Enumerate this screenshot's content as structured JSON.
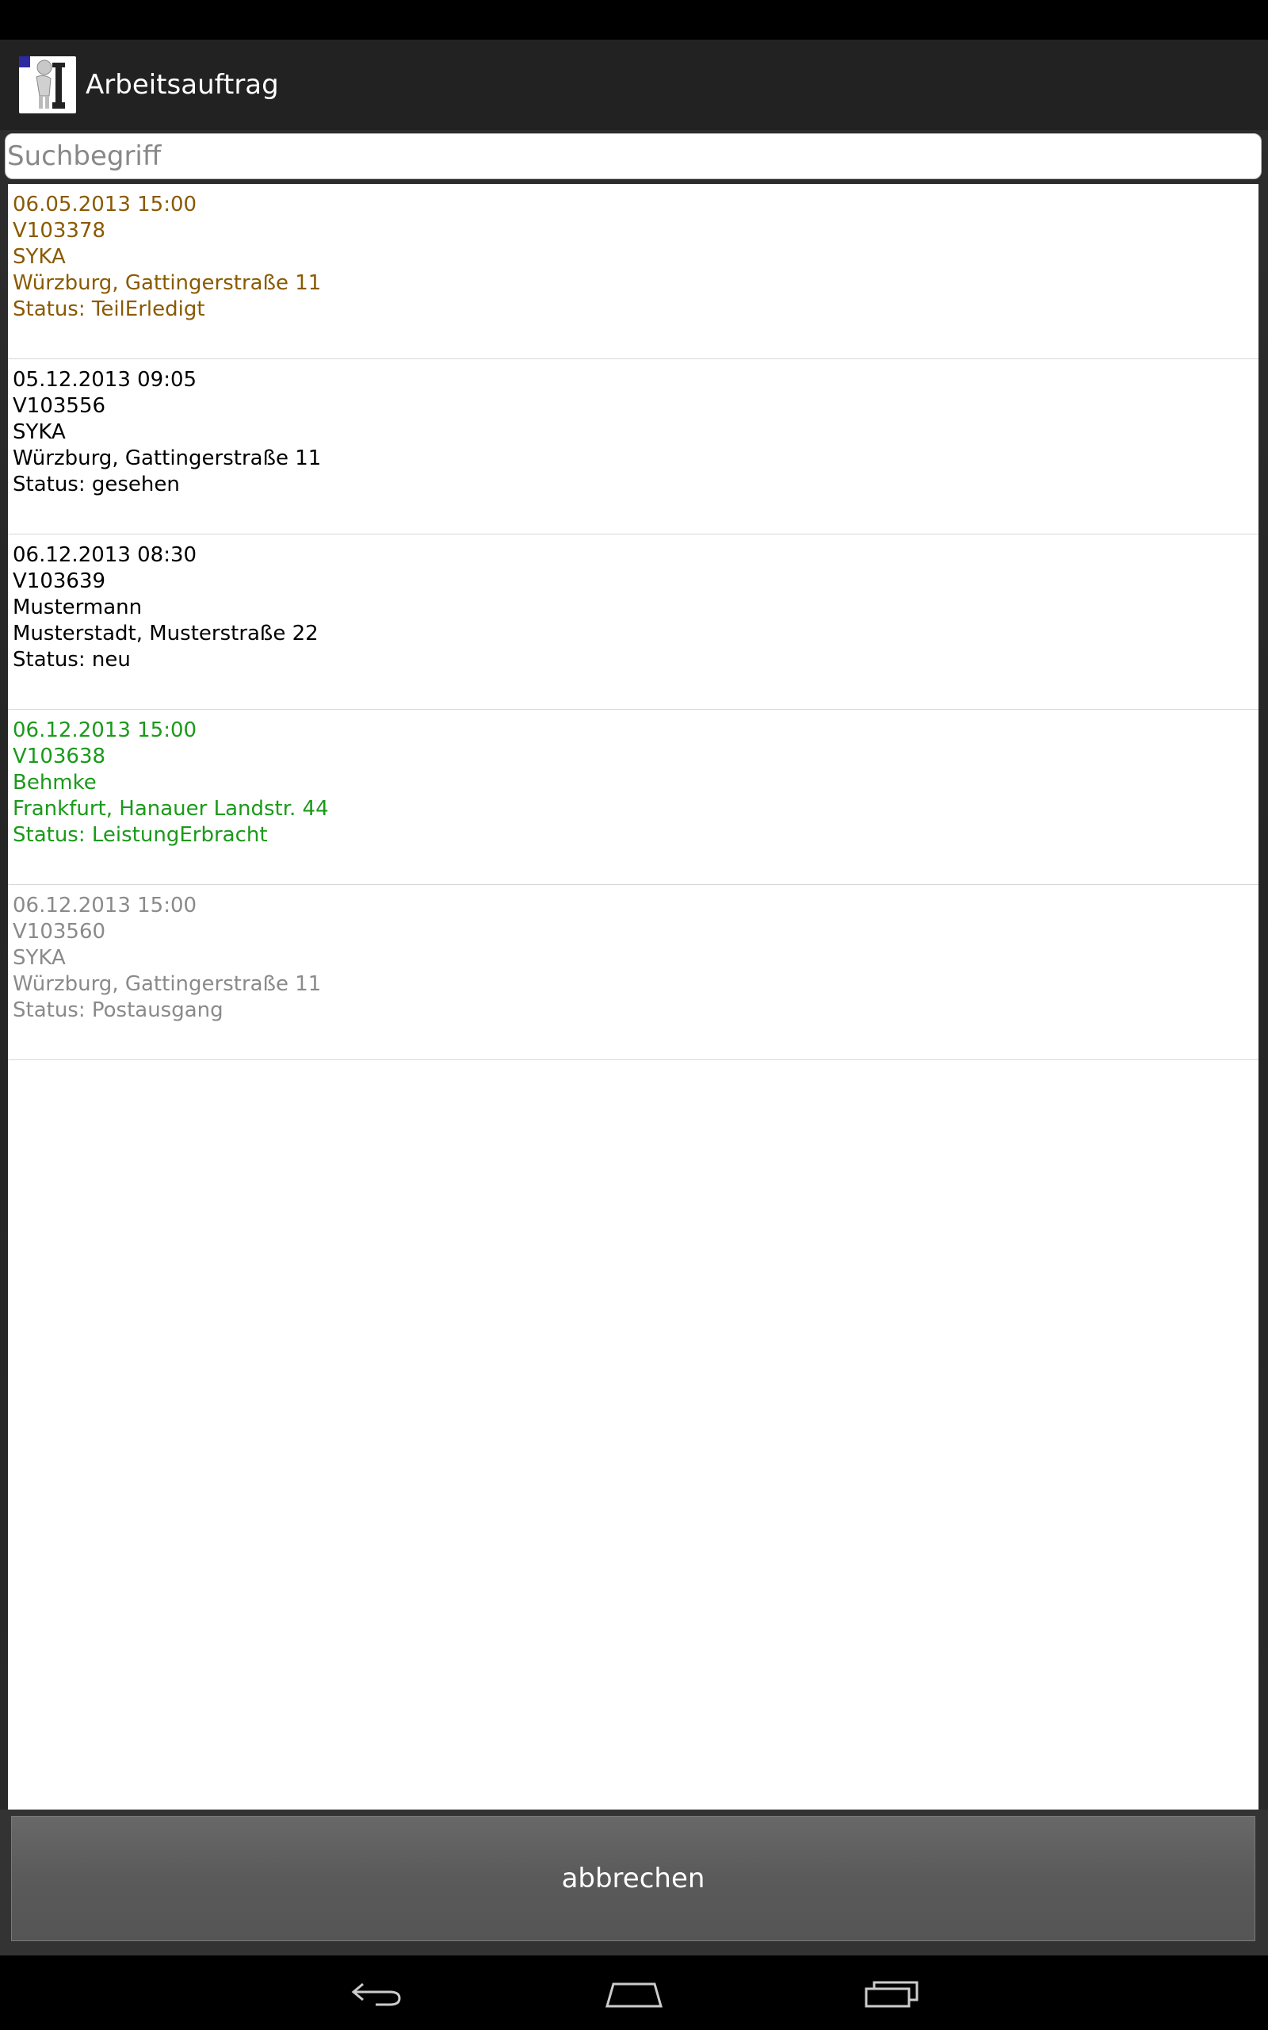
{
  "app": {
    "title": "Arbeitsauftrag",
    "icon": "wrench-worker-icon"
  },
  "search": {
    "placeholder": "Suchbegriff",
    "value": ""
  },
  "items": [
    {
      "datetime": "06.05.2013 15:00",
      "id": "V103378",
      "customer": "SYKA",
      "address": "Würzburg, Gattingerstraße 11",
      "status": "Status: TeilErledigt",
      "color": "#8a5a00"
    },
    {
      "datetime": "05.12.2013 09:05",
      "id": "V103556",
      "customer": "SYKA",
      "address": "Würzburg, Gattingerstraße 11",
      "status": "Status: gesehen",
      "color": "#000000"
    },
    {
      "datetime": "06.12.2013 08:30",
      "id": "V103639",
      "customer": "Mustermann",
      "address": "Musterstadt, Musterstraße 22",
      "status": "Status: neu",
      "color": "#000000"
    },
    {
      "datetime": "06.12.2013 15:00",
      "id": "V103638",
      "customer": "Behmke",
      "address": "Frankfurt, Hanauer Landstr. 44",
      "status": "Status: LeistungErbracht",
      "color": "#1a9a1a"
    },
    {
      "datetime": "06.12.2013 15:00",
      "id": "V103560",
      "customer": "SYKA",
      "address": "Würzburg, Gattingerstraße 11",
      "status": "Status: Postausgang",
      "color": "#8a8a8a"
    }
  ],
  "footer": {
    "cancel_label": "abbrechen"
  },
  "navigation": {
    "back": "back-icon",
    "home": "home-icon",
    "recents": "recent-apps-icon"
  }
}
